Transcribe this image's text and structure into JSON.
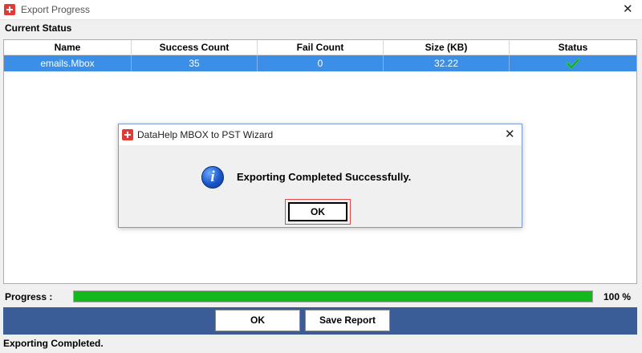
{
  "window": {
    "title": "Export Progress",
    "brand_color": "#e53935"
  },
  "section": {
    "label": "Current Status"
  },
  "table": {
    "columns": [
      "Name",
      "Success Count",
      "Fail Count",
      "Size (KB)",
      "Status"
    ],
    "rows": [
      {
        "name": "emails.Mbox",
        "success_count": "35",
        "fail_count": "0",
        "size_kb": "32.22",
        "status_icon": "check-icon"
      }
    ],
    "selected_row_color": "#3b8fe6"
  },
  "progress": {
    "label": "Progress :",
    "value": 100,
    "percent_text": "100 %",
    "fill_color": "#14b81d"
  },
  "buttons": {
    "ok": "OK",
    "save_report": "Save Report"
  },
  "status_bar": {
    "text": "Exporting Completed."
  },
  "dialog": {
    "title": "DataHelp MBOX to PST Wizard",
    "message": "Exporting Completed Successfully.",
    "icon": "info-icon",
    "ok_label": "OK"
  }
}
